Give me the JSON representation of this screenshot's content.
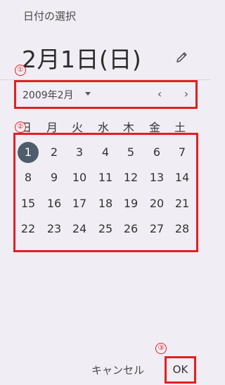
{
  "dialog": {
    "title": "日付の選択",
    "selected_date": "2月1日(日)",
    "month_label": "2009年2月"
  },
  "weekdays": [
    "日",
    "月",
    "火",
    "水",
    "木",
    "金",
    "土"
  ],
  "days": [
    [
      "1",
      "2",
      "3",
      "4",
      "5",
      "6",
      "7"
    ],
    [
      "8",
      "9",
      "10",
      "11",
      "12",
      "13",
      "14"
    ],
    [
      "15",
      "16",
      "17",
      "18",
      "19",
      "20",
      "21"
    ],
    [
      "22",
      "23",
      "24",
      "25",
      "26",
      "27",
      "28"
    ]
  ],
  "selected_day": "1",
  "annotations": [
    "①",
    "②",
    "③"
  ],
  "actions": {
    "cancel_label": "キャンセル",
    "ok_label": "OK"
  },
  "colors": {
    "background": "#f1edf4",
    "highlight": "#e02020",
    "selected_day_bg": "#4f5d6b"
  },
  "icons": {
    "edit": "pencil-icon",
    "dropdown": "caret-down-icon",
    "prev": "chevron-left-icon",
    "next": "chevron-right-icon"
  }
}
